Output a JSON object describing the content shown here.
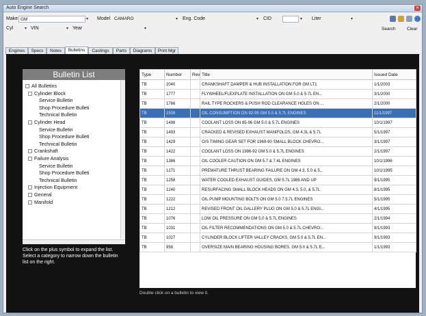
{
  "window": {
    "title": "Auto Engine Search"
  },
  "search": {
    "make_label": "Make",
    "make_value": "GM",
    "model_label": "Model",
    "model_value": "CAMARO",
    "eng_code_label": "Eng. Code",
    "cid_label": "CID",
    "liter_label": "Liter",
    "cyl_label": "Cyl",
    "vin_label": "VIN",
    "year_label": "Year",
    "search_button": "Search",
    "clear_button": "Clear"
  },
  "tabs": [
    "Engines",
    "Specs",
    "Notes",
    "Bulletins",
    "Castings",
    "Parts",
    "Diagrams",
    "Print Mgr"
  ],
  "active_tab": "Bulletins",
  "bulletin_list": {
    "title": "Bulletin List",
    "tree": [
      {
        "label": "All Bulletins",
        "level": 0,
        "box": "-"
      },
      {
        "label": "Cylinder Block",
        "level": 1,
        "box": "-"
      },
      {
        "label": "Service Bulletin",
        "level": 2
      },
      {
        "label": "Shop Procedure Bulleti",
        "level": 2
      },
      {
        "label": "Technical Bulletin",
        "level": 2
      },
      {
        "label": "Cylinder Head",
        "level": 1,
        "box": "-"
      },
      {
        "label": "Service Bulletin",
        "level": 2
      },
      {
        "label": "Shop Procedure Bulleti",
        "level": 2
      },
      {
        "label": "Technical Bulletin",
        "level": 2
      },
      {
        "label": "Crankshaft",
        "level": 1,
        "box": "+"
      },
      {
        "label": "Failure Analysis",
        "level": 1,
        "box": "-"
      },
      {
        "label": "Service Bulletin",
        "level": 2
      },
      {
        "label": "Shop Procedure Bulleti",
        "level": 2
      },
      {
        "label": "Technical Bulletin",
        "level": 2
      },
      {
        "label": "Injection Equipment",
        "level": 1,
        "box": "+"
      },
      {
        "label": "General",
        "level": 1,
        "box": "+"
      },
      {
        "label": "Manifold",
        "level": 1,
        "box": "+"
      }
    ],
    "hint": "Click on the plus symbol to expand the list. Select a category to narrow down the bulletin list on the right."
  },
  "table": {
    "columns": [
      "Type",
      "Number",
      "Rev",
      "Title",
      "Issued Date"
    ],
    "rows": [
      [
        "TB",
        "2040",
        "",
        "CRANKSHAFT DAMPER & HUB INSTALLATION FOR GM LT1",
        "1/1/2003"
      ],
      [
        "TB",
        "1777",
        "",
        "FLYWHEEL/FLEXPLATE INSTALLATION ON GM 5.0 & 5.7L EN...",
        "3/1/2000"
      ],
      [
        "TB",
        "1766",
        "",
        "RAIL TYPE ROCKERS & PUSH ROD CLEARANCE HOLES ON ...",
        "2/1/2000"
      ],
      [
        "TB",
        "1508",
        "",
        "OIL CONSUMPTION ON 92-95 GM 5.0 & 5.7L ENGINES",
        "11/1/1997"
      ],
      [
        "TB",
        "1498",
        "",
        "COOLANT LOSS ON 85-96 GM 5.0 & 5.7L ENGINES",
        "10/1/1997"
      ],
      [
        "TB",
        "1493",
        "",
        "CRACKED & REVISED EXHAUST MANIFOLDS, GM 4.3L & 5.7L",
        "5/1/1997"
      ],
      [
        "TB",
        "1429",
        "",
        "O/S TIMING GEAR SET FOR 1969-90 SMALL BLOCK CHEVRO...",
        "3/1/1997"
      ],
      [
        "TB",
        "1422",
        "",
        "COOLANT LOSS ON 1986-92 GM 5.0 & 5.7L ENGINES",
        "2/1/1997"
      ],
      [
        "TB",
        "1386",
        "",
        "OIL COOLER CAUTION ON GM 5.7 & 7.4L ENGINES",
        "10/1/1996"
      ],
      [
        "TB",
        "1271",
        "",
        "PREMATURE THRUST BEARING FAILURE ON GM 4.3, 5.0 & 5...",
        "10/1/1995"
      ],
      [
        "TB",
        "1258",
        "",
        "WATER COOLED EXHAUST GUIDES, GM 5.7L 1986 AND UP",
        "9/1/1995"
      ],
      [
        "TB",
        "1240",
        "",
        "RESURFACING SMALL BLOCK HEADS ON GM 4.3, 5.0, & 5.7L",
        "8/1/1995"
      ],
      [
        "TB",
        "1222",
        "",
        "OIL PUMP MOUNTING BOLTS ON GM 5.0 7.5.7L ENGINES",
        "5/1/1995"
      ],
      [
        "TB",
        "1212",
        "",
        "REVISED FRONT OIL GALLERY PLUG ON GM 5.0 & 5.7L ENGI...",
        "4/1/1995"
      ],
      [
        "TB",
        "1076",
        "",
        "LOW OIL PRESSURE ON GM 5.0 & 5.7L ENGINES",
        "2/1/1994"
      ],
      [
        "TB",
        "1031",
        "",
        "OIL FILTER RECOMMENDATIONS ON GM 5.0 & 5.7L CHEVRO...",
        "9/1/1993"
      ],
      [
        "TB",
        "1027",
        "",
        "CYLINDER BLOCK LIFTER VALLEY CRACKS, GM 5.0 & 5.7L EN...",
        "9/1/1993"
      ],
      [
        "TB",
        "958",
        "",
        "OVERSIZE MAIN BEARING HOUSING BORES, GM 5.0 & 5.7L E...",
        "1/1/1993"
      ]
    ],
    "selected_row": 3
  },
  "footer": "Double click on a bulletin to view it."
}
